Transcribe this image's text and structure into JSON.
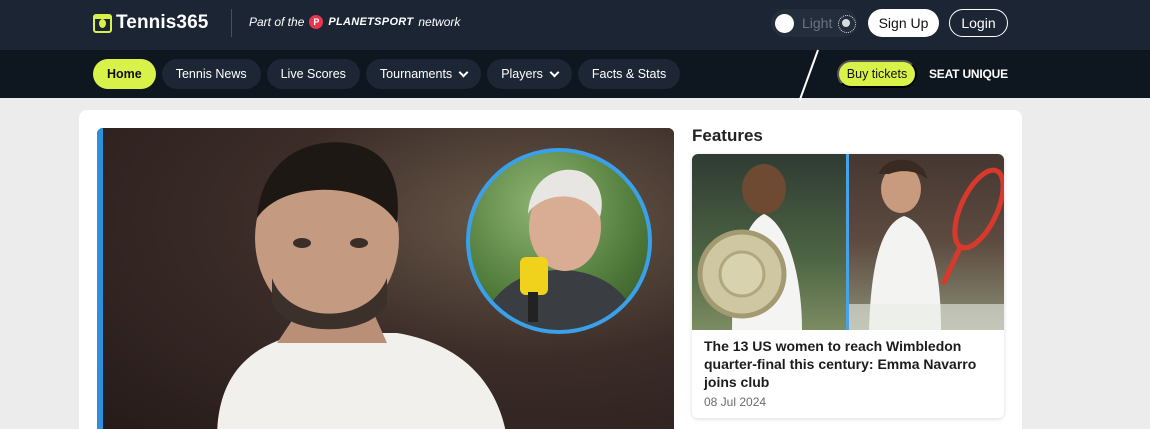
{
  "site": {
    "logo_text": "Tennis365",
    "network_prefix": "Part of the",
    "network_brand": "PLANETSPORT",
    "network_suffix": "network"
  },
  "header": {
    "theme_label": "Light",
    "signup_label": "Sign Up",
    "login_label": "Login"
  },
  "nav": {
    "items": [
      {
        "label": "Home",
        "active": true
      },
      {
        "label": "Tennis News"
      },
      {
        "label": "Live Scores"
      },
      {
        "label": "Tournaments",
        "dropdown": true
      },
      {
        "label": "Players",
        "dropdown": true
      },
      {
        "label": "Facts & Stats"
      }
    ],
    "tickets_label": "Buy tickets",
    "partner_label": "SEAT UNIQUE"
  },
  "features": {
    "title": "Features",
    "card": {
      "headline": "The 13 US women to reach Wimbledon quarter-final this century: Emma Navarro joins club",
      "date": "08 Jul 2024"
    }
  },
  "colors": {
    "accent": "#d9f24a",
    "topbar": "#1b2533",
    "navbar": "#0e1620",
    "highlight_blue": "#2f8fdf"
  }
}
